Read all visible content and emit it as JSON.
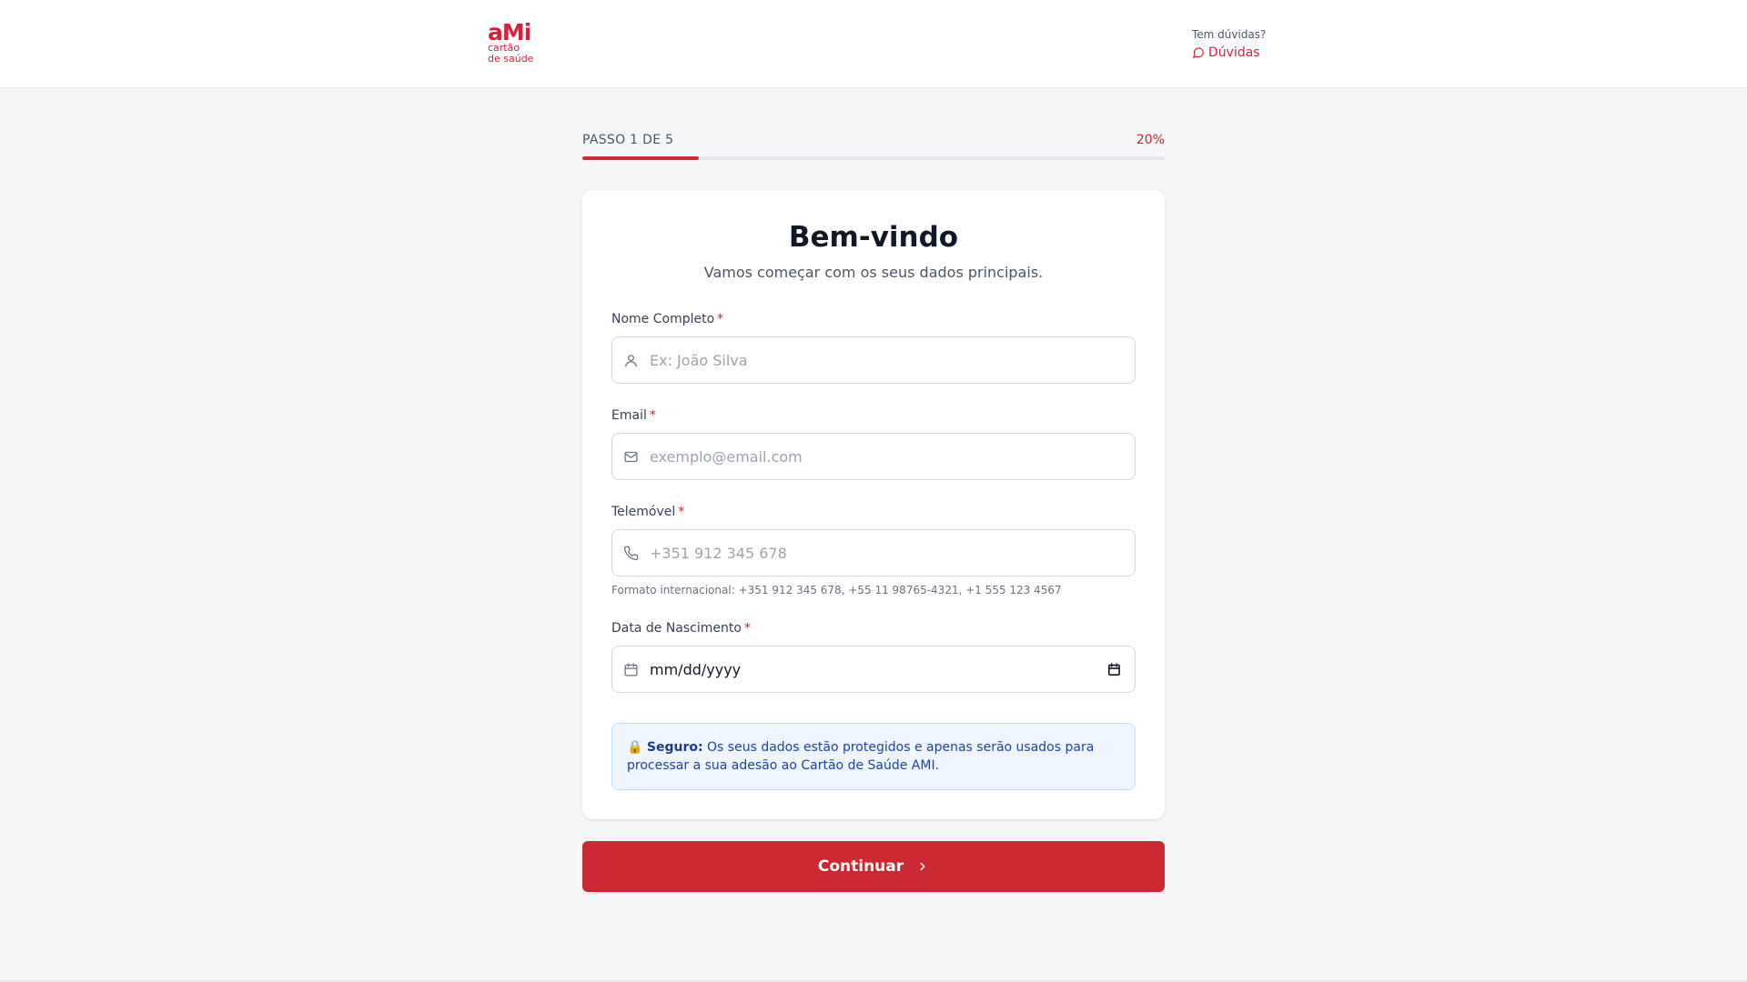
{
  "brand": {
    "logo_mark": "aMi",
    "logo_line1": "cartão",
    "logo_line2": "de saúde",
    "color": "#d6213a"
  },
  "header": {
    "help_question": "Tem dúvidas?",
    "help_link": "Dúvidas"
  },
  "progress": {
    "step_label": "PASSO 1 DE 5",
    "percent_label": "20%",
    "fraction": 0.2
  },
  "form": {
    "title": "Bem-vindo",
    "subtitle": "Vamos começar com os seus dados principais.",
    "name": {
      "label": "Nome Completo",
      "required": "*",
      "placeholder": "Ex: João Silva",
      "icon": "user-icon"
    },
    "email": {
      "label": "Email",
      "required": "*",
      "placeholder": "exemplo@email.com",
      "icon": "mail-icon"
    },
    "phone": {
      "label": "Telemóvel",
      "required": "*",
      "placeholder": "+351 912 345 678",
      "icon": "phone-icon",
      "hint": "Formato internacional: +351 912 345 678, +55 11 98765-4321, +1 555 123 4567"
    },
    "birthdate": {
      "label": "Data de Nascimento",
      "required": "*",
      "value": "mm/dd/yyyy",
      "icon": "calendar-icon"
    },
    "secure": {
      "emoji": "🔒",
      "strong": "Seguro:",
      "text": "Os seus dados estão protegidos e apenas serão usados para processar a sua adesão ao Cartão de Saúde AMI."
    }
  },
  "actions": {
    "continue_label": "Continuar"
  },
  "colors": {
    "accent": "#d6213a",
    "button": "#cc2831",
    "info_bg": "#eff6ff",
    "info_text": "#1e40af"
  }
}
